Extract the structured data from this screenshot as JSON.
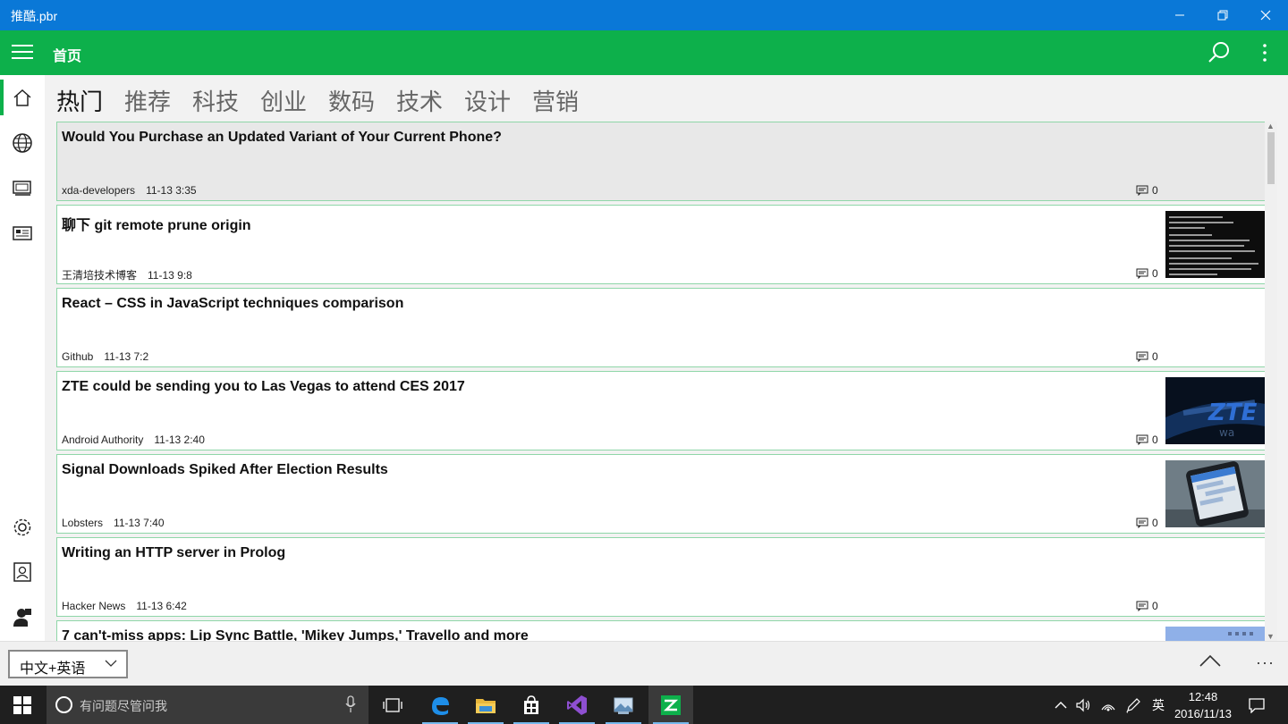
{
  "window": {
    "title": "推酷.pbr",
    "minimize_glyph": "—",
    "maximize_glyph": "❐",
    "close_glyph": "✕"
  },
  "appbar": {
    "title": "首页",
    "menu_icon": "hamburger-icon",
    "search_icon": "search-icon",
    "more_icon": "more-vertical-icon"
  },
  "sidebar": {
    "items": [
      {
        "name": "home",
        "icon": "home-icon",
        "active": true
      },
      {
        "name": "globe",
        "icon": "globe-icon",
        "active": false
      },
      {
        "name": "topics",
        "icon": "stack-icon",
        "active": false
      },
      {
        "name": "news",
        "icon": "newspaper-icon",
        "active": false
      }
    ],
    "bottom_items": [
      {
        "name": "settings",
        "icon": "gear-icon"
      },
      {
        "name": "account",
        "icon": "contact-icon"
      },
      {
        "name": "profile",
        "icon": "person-icon"
      }
    ]
  },
  "tabs": [
    "热门",
    "推荐",
    "科技",
    "创业",
    "数码",
    "技术",
    "设计",
    "营销"
  ],
  "active_tab": "热门",
  "articles": [
    {
      "title": "Would You Purchase an Updated Variant of Your Current Phone?",
      "source": "xda-developers",
      "time": "11-13 3:35",
      "comments": "0",
      "thumb": "none",
      "selected": true
    },
    {
      "title": "聊下 git remote prune origin",
      "source": "王清培技术博客",
      "time": "11-13 9:8",
      "comments": "0",
      "thumb": "terminal"
    },
    {
      "title": "React – CSS in JavaScript techniques comparison",
      "source": "Github",
      "time": "11-13 7:2",
      "comments": "0",
      "thumb": "none"
    },
    {
      "title": "ZTE could be sending you to Las Vegas to attend CES 2017",
      "source": "Android Authority",
      "time": "11-13 2:40",
      "comments": "0",
      "thumb": "zte"
    },
    {
      "title": "Signal Downloads Spiked After Election Results",
      "source": "Lobsters",
      "time": "11-13 7:40",
      "comments": "0",
      "thumb": "phone"
    },
    {
      "title": "Writing an HTTP server in Prolog",
      "source": "Hacker News",
      "time": "11-13 6:42",
      "comments": "0",
      "thumb": "none"
    },
    {
      "title": "7 can't-miss apps: Lip Sync Battle, 'Mikey Jumps,' Travello and more",
      "source": "",
      "time": "",
      "comments": "",
      "thumb": "partial"
    }
  ],
  "bottombar": {
    "language_selected": "中文+英语",
    "collapse_icon": "chevron-up-icon",
    "more_label": "···"
  },
  "taskbar": {
    "search_placeholder": "有问题尽管问我",
    "apps": [
      "task-view-icon",
      "edge-icon",
      "file-explorer-icon",
      "store-icon",
      "visual-studio-icon",
      "photos-icon",
      "tuicool-icon"
    ],
    "ime_label": "英",
    "time": "12:48",
    "date": "2016/11/13"
  },
  "colors": {
    "titlebar": "#0a78d7",
    "accent": "#0db04b",
    "card_border": "#8fd6a8",
    "taskbar": "#1f1f1f"
  }
}
